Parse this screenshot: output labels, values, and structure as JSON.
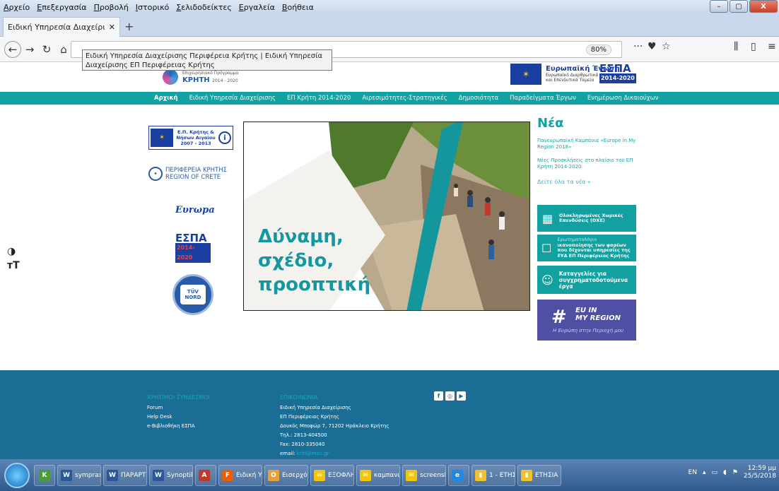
{
  "menubar": {
    "items": [
      "Αρχείο",
      "Επεξεργασία",
      "Προβολή",
      "Ιστορικό",
      "Σελιδοδείκτες",
      "Εργαλεία",
      "Βοήθεια"
    ]
  },
  "tab": {
    "title": "Ειδική Υπηρεσία Διαχείρισης Περι"
  },
  "toolbar": {
    "zoom": "80%"
  },
  "tooltip": "Ειδική Υπηρεσία Διαχείρισης Περιφέρεια Κρήτης | Ειδική Υπηρεσία Διαχείρισης ΕΠ Περιφέρειας Κρήτης",
  "header": {
    "program_small": "Επιχειρησιακό Πρόγραμμα",
    "program_name": "ΚΡΗΤΗ",
    "program_years": "2014 - 2020",
    "eu_title": "Ευρωπαϊκή Ένωση",
    "eu_line1": "Ευρωπαϊκό Διαρθρωτικά",
    "eu_line2": "και Επενδυτικά Ταμεία",
    "espa": "ΕΣΠΑ",
    "espa_years": "2014-2020"
  },
  "nav": {
    "items": [
      "Αρχική",
      "Ειδική Υπηρεσία Διαχείρισης",
      "ΕΠ Κρήτη 2014-2020",
      "Αιρεσιμότητες-Στρατηγικές",
      "Δημοσιότητα",
      "Παραδείγματα Έργων",
      "Ενημέρωση Δικαιούχων"
    ]
  },
  "left": {
    "ep_line1": "Ε.Π. Κρήτης &",
    "ep_line2": "Νήσων Αιγαίου",
    "ep_line3": "2007 - 2013",
    "perif_line1": "ΠΕΡΙΦΕΡΕΙΑ ΚΡΗΤΗΣ",
    "perif_line2": "REGION OF CRETE",
    "europa": "Ευrωpa",
    "espa": "ΕΣΠΑ",
    "espa_years": "2014-2020",
    "tuv": "TÜV NORD"
  },
  "hero": {
    "line1": "Δύναμη,",
    "line2": "σχέδιο,",
    "line3": "προοπτική"
  },
  "news": {
    "title": "Νέα",
    "items": [
      "Πανευρωπαϊκή Καμπάνια «Europe in My Region 2018»",
      "Νέες Προσκλήσεις στο πλαίσιο του ΕΠ Κρήτη 2014-2020"
    ],
    "more": "Δείτε όλα τα νέα »"
  },
  "tiles": {
    "oxe": "Ολοκληρωμένες Χωρικές Επενδύσεις (ΟΧΕ)",
    "q_title": "Ερωτηματολόγιο",
    "q_text": "ικανοποίησης των φορέων που δέχονται υπηρεσίες της ΕΥΔ ΕΠ Περιφέρειας Κρήτης",
    "complaints": "Καταγγελίες για συγχρηματοδοτούμενα έργα",
    "euin_line1": "EU IN",
    "euin_line2": "MY REGION",
    "euin_sub": "Η Ευρώπη στην Περιοχή μου"
  },
  "sidetools": {
    "contrast": "◑",
    "text": "тT"
  },
  "footer": {
    "links_title": "ΧΡΗΣΙΜΟΙ ΣΥΝΔΕΣΜΟΙ",
    "links": [
      "Forum",
      "Help Desk",
      "e-Βιβλιοθήκη ΕΣΠΑ"
    ],
    "contact_title": "ΕΠΙΚΟΙΝΩΝΙΑ",
    "contact": [
      "Ειδική Υπηρεσία Διαχείρισης",
      "ΕΠ Περιφέρειας Κρήτης",
      "Δουκός Μποφώρ 7, 71202 Ηράκλειο Κρήτης",
      "Τηλ.: 2813-404500",
      "Fax: 2810-335040"
    ],
    "email_label": "email:",
    "email_value": "kriti@mou.gr"
  },
  "taskbar": {
    "items": [
      {
        "icon": "W",
        "label": "sympraxis..."
      },
      {
        "icon": "W",
        "label": "ΠΑΡΑΡΤΗ..."
      },
      {
        "icon": "W",
        "label": "Synoptiki..."
      },
      {
        "icon": "A",
        "label": ""
      },
      {
        "icon": "F",
        "label": "Ειδική Υπ..."
      },
      {
        "icon": "O",
        "label": "Εισερχόμ..."
      },
      {
        "icon": "✉",
        "label": "ΕΞΟΦΛΗΣ..."
      },
      {
        "icon": "✉",
        "label": "καμπανια..."
      },
      {
        "icon": "✉",
        "label": "screensho..."
      },
      {
        "icon": "e",
        "label": ""
      },
      {
        "icon": "▮",
        "label": "1 - ΕΤΗΣΙ..."
      },
      {
        "icon": "▮",
        "label": "ΕΤΗΣΙΑ Ε..."
      }
    ],
    "lang": "EN",
    "time": "12:59 μμ",
    "date": "25/5/2018"
  }
}
